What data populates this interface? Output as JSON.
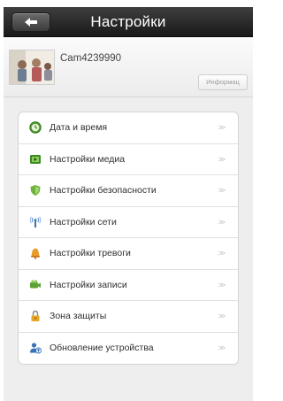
{
  "header": {
    "title": "Настройки",
    "back_icon": "back-arrow-icon"
  },
  "device": {
    "name": "Cam4239990",
    "info_button": "Информац"
  },
  "settings": {
    "items": [
      {
        "label": "Дата и время",
        "icon": "clock-icon",
        "color": "#3f8f2a"
      },
      {
        "label": "Настройки медиа",
        "icon": "media-icon",
        "color": "#3a7d23"
      },
      {
        "label": "Настройки безопасности",
        "icon": "shield-icon",
        "color": "#5aa63a"
      },
      {
        "label": "Настройки сети",
        "icon": "network-icon",
        "color": "#3b73b8"
      },
      {
        "label": "Настройки тревоги",
        "icon": "alarm-bell-icon",
        "color": "#e08a1e"
      },
      {
        "label": "Настройки записи",
        "icon": "record-icon",
        "color": "#5a9a34"
      },
      {
        "label": "Зона защиты",
        "icon": "lock-icon",
        "color": "#e0a32a"
      },
      {
        "label": "Обновление устройства",
        "icon": "device-update-icon",
        "color": "#3b73b8"
      }
    ],
    "chevron": ">>"
  }
}
